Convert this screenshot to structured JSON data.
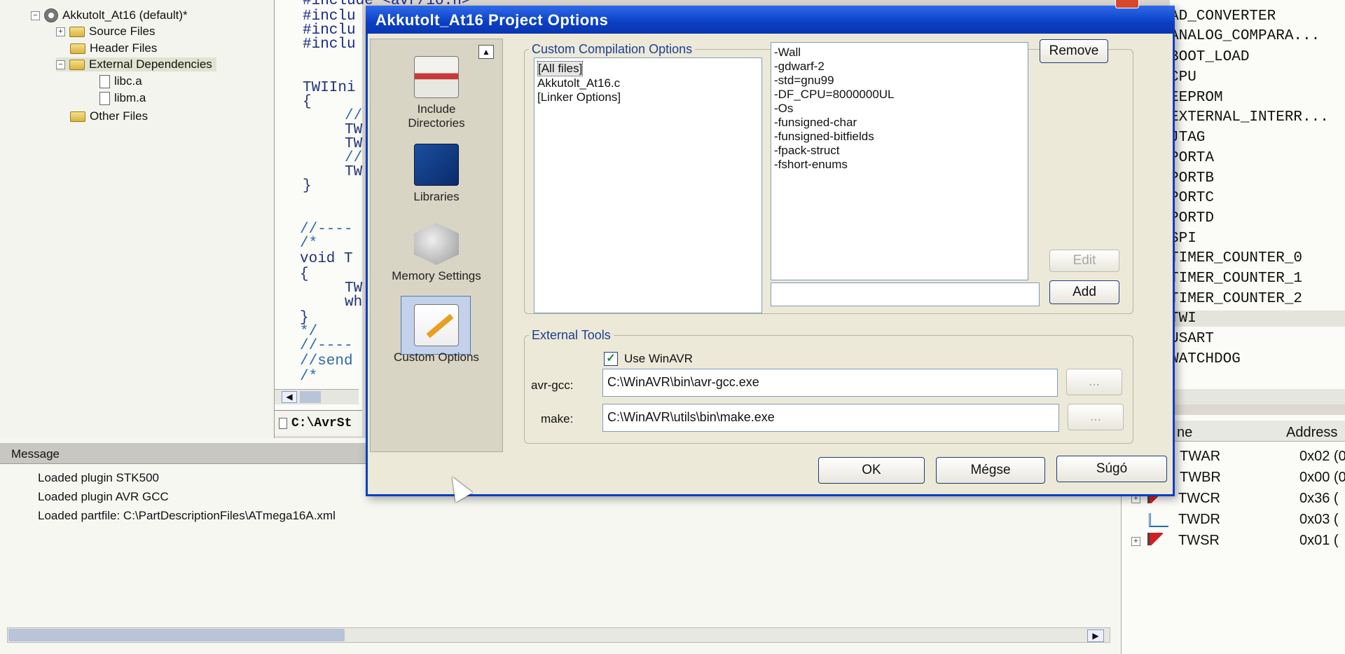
{
  "tree": {
    "project": "Akkutolt_At16 (default)*",
    "items": [
      {
        "label": "Source Files"
      },
      {
        "label": "Header Files"
      },
      {
        "label": "External Dependencies"
      },
      {
        "label": "libc.a"
      },
      {
        "label": "libm.a"
      },
      {
        "label": "Other Files"
      }
    ]
  },
  "editor": {
    "lines": [
      "#include <avr/io.h>",
      "#inclu",
      "#inclu",
      "#inclu",
      "TWIIni",
      "{",
      "//",
      "TW",
      "TW",
      "//",
      "TW",
      "}",
      "//----",
      "/*",
      "void T",
      "{",
      "TW",
      "wh",
      "}",
      "*/",
      "//----",
      "//send",
      "/*"
    ],
    "tab": "C:\\AvrSt"
  },
  "messages": {
    "header": "Message",
    "items": [
      "Loaded plugin STK500",
      "Loaded plugin AVR GCC",
      "Loaded partfile: C:\\PartDescriptionFiles\\ATmega16A.xml"
    ]
  },
  "io_view": {
    "items": [
      "AD_CONVERTER",
      "ANALOG_COMPARA...",
      "BOOT_LOAD",
      "CPU",
      "EEPROM",
      "EXTERNAL_INTERR...",
      "JTAG",
      "PORTA",
      "PORTB",
      "PORTC",
      "PORTD",
      "SPI",
      "TIMER_COUNTER_0",
      "TIMER_COUNTER_1",
      "TIMER_COUNTER_2",
      "TWI",
      "USART",
      "WATCHDOG"
    ],
    "columns": [
      "ne",
      "Address"
    ],
    "registers": [
      {
        "name": "TWAR",
        "addr": "0x02 (0"
      },
      {
        "name": "TWBR",
        "addr": "0x00 (0"
      },
      {
        "name": "TWCR",
        "addr": "0x36 ("
      },
      {
        "name": "TWDR",
        "addr": "0x03 ("
      },
      {
        "name": "TWSR",
        "addr": "0x01 ("
      }
    ]
  },
  "dialog": {
    "title": "Akkutolt_At16 Project Options",
    "nav": [
      {
        "label1": "Include",
        "label2": "Directories"
      },
      {
        "label1": "Libraries",
        "label2": ""
      },
      {
        "label1": "Memory Settings",
        "label2": ""
      },
      {
        "label1": "Custom Options",
        "label2": ""
      }
    ],
    "custom": {
      "legend": "Custom Compilation Options",
      "files": [
        "[All files]",
        "Akkutolt_At16.c",
        "[Linker Options]"
      ],
      "options": [
        "-Wall",
        "-gdwarf-2",
        "-std=gnu99",
        "-DF_CPU=8000000UL",
        "-Os",
        "-funsigned-char",
        "-funsigned-bitfields",
        "-fpack-struct",
        "-fshort-enums"
      ],
      "new_option_value": "",
      "remove": "Remove",
      "edit": "Edit",
      "add": "Add"
    },
    "tools": {
      "legend": "External Tools",
      "use_winavr": "Use WinAVR",
      "use_winavr_checked": true,
      "gcc_label": "avr-gcc:",
      "gcc_path": "C:\\WinAVR\\bin\\avr-gcc.exe",
      "make_label": "make:",
      "make_path": "C:\\WinAVR\\utils\\bin\\make.exe",
      "browse": "..."
    },
    "ok": "OK",
    "cancel": "Mégse",
    "help": "Súgó"
  },
  "colors": {
    "title_blue": "#0a3fc4",
    "legend_blue": "#1d3f8f",
    "dialog_bg": "#ece9d8"
  }
}
